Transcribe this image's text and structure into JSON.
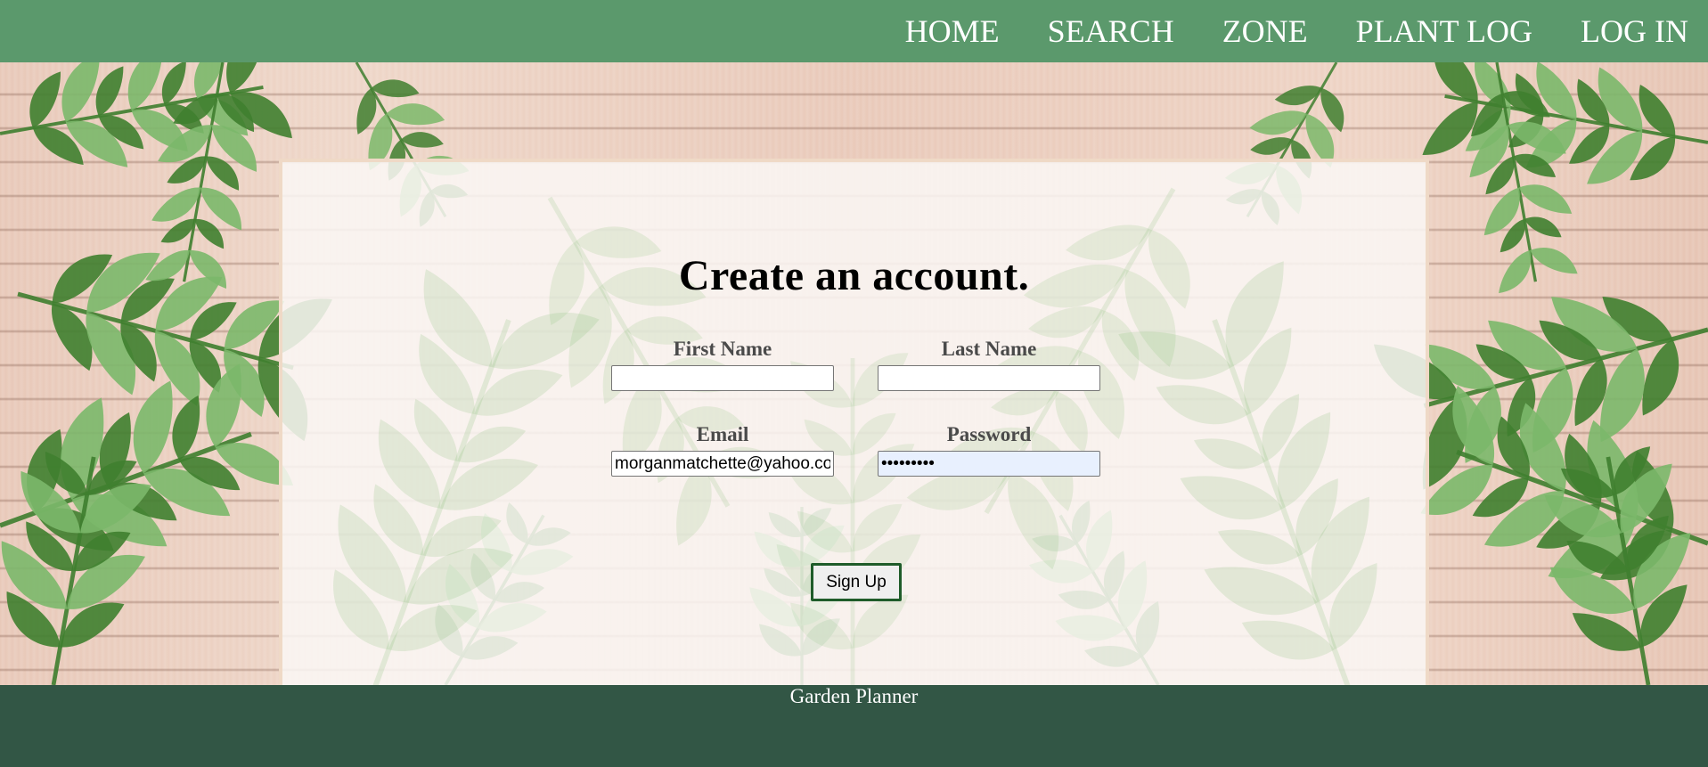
{
  "nav": {
    "items": [
      {
        "label": "HOME"
      },
      {
        "label": "SEARCH"
      },
      {
        "label": "ZONE"
      },
      {
        "label": "PLANT LOG"
      },
      {
        "label": "LOG IN"
      }
    ]
  },
  "form": {
    "title": "Create an account.",
    "first_name": {
      "label": "First Name",
      "value": ""
    },
    "last_name": {
      "label": "Last Name",
      "value": ""
    },
    "email": {
      "label": "Email",
      "value": "morganmatchette@yahoo.com"
    },
    "password": {
      "label": "Password",
      "value": "abcdefghi"
    },
    "submit_label": "Sign Up"
  },
  "footer": {
    "text": "Garden Planner"
  },
  "colors": {
    "nav_bg": "#5b996c",
    "footer_bg": "#325645",
    "button_border": "#1f5c2a",
    "leaf_dark": "#3f7f2f",
    "leaf_light": "#7bb86a"
  },
  "icons": {
    "background": "leaf-pattern-icon"
  }
}
